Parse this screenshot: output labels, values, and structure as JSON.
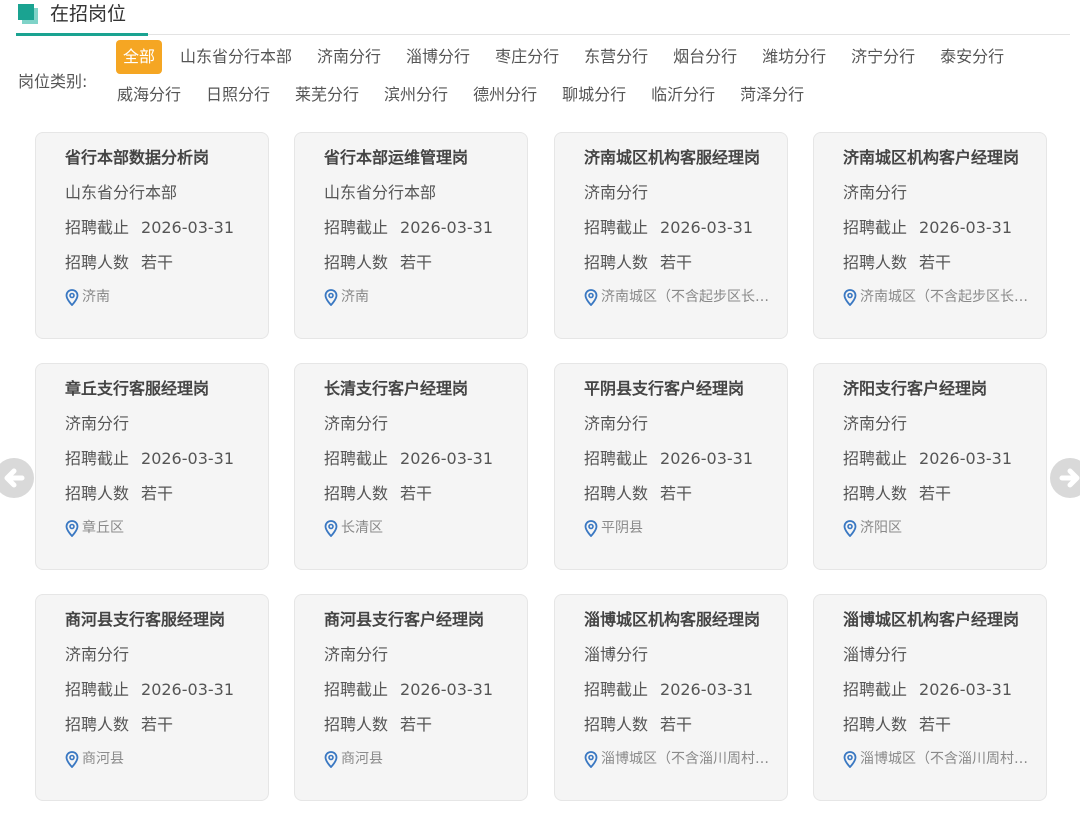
{
  "section": {
    "title": "在招岗位"
  },
  "filter": {
    "label": "岗位类别:",
    "row1": [
      "全部",
      "山东省分行本部",
      "济南分行",
      "淄博分行",
      "枣庄分行",
      "东营分行",
      "烟台分行",
      "潍坊分行",
      "济宁分行",
      "泰安分行"
    ],
    "row2": [
      "威海分行",
      "日照分行",
      "莱芜分行",
      "滨州分行",
      "德州分行",
      "聊城分行",
      "临沂分行",
      "菏泽分行"
    ],
    "active": "全部"
  },
  "card_labels": {
    "deadline": "招聘截止",
    "headcount": "招聘人数"
  },
  "jobs": [
    {
      "title": "省行本部数据分析岗",
      "branch": "山东省分行本部",
      "deadline": "2026-03-31",
      "headcount": "若干",
      "location": "济南"
    },
    {
      "title": "省行本部运维管理岗",
      "branch": "山东省分行本部",
      "deadline": "2026-03-31",
      "headcount": "若干",
      "location": "济南"
    },
    {
      "title": "济南城区机构客服经理岗",
      "branch": "济南分行",
      "deadline": "2026-03-31",
      "headcount": "若干",
      "location": "济南城区（不含起步区长…"
    },
    {
      "title": "济南城区机构客户经理岗",
      "branch": "济南分行",
      "deadline": "2026-03-31",
      "headcount": "若干",
      "location": "济南城区（不含起步区长…"
    },
    {
      "title": "章丘支行客服经理岗",
      "branch": "济南分行",
      "deadline": "2026-03-31",
      "headcount": "若干",
      "location": "章丘区"
    },
    {
      "title": "长清支行客户经理岗",
      "branch": "济南分行",
      "deadline": "2026-03-31",
      "headcount": "若干",
      "location": "长清区"
    },
    {
      "title": "平阴县支行客户经理岗",
      "branch": "济南分行",
      "deadline": "2026-03-31",
      "headcount": "若干",
      "location": "平阴县"
    },
    {
      "title": "济阳支行客户经理岗",
      "branch": "济南分行",
      "deadline": "2026-03-31",
      "headcount": "若干",
      "location": "济阳区"
    },
    {
      "title": "商河县支行客服经理岗",
      "branch": "济南分行",
      "deadline": "2026-03-31",
      "headcount": "若干",
      "location": "商河县"
    },
    {
      "title": "商河县支行客户经理岗",
      "branch": "济南分行",
      "deadline": "2026-03-31",
      "headcount": "若干",
      "location": "商河县"
    },
    {
      "title": "淄博城区机构客服经理岗",
      "branch": "淄博分行",
      "deadline": "2026-03-31",
      "headcount": "若干",
      "location": "淄博城区（不含淄川周村…"
    },
    {
      "title": "淄博城区机构客户经理岗",
      "branch": "淄博分行",
      "deadline": "2026-03-31",
      "headcount": "若干",
      "location": "淄博城区（不含淄川周村…"
    }
  ],
  "colors": {
    "accent": "#1aa391",
    "active_chip": "#f5a623",
    "pin": "#3a78c2"
  }
}
